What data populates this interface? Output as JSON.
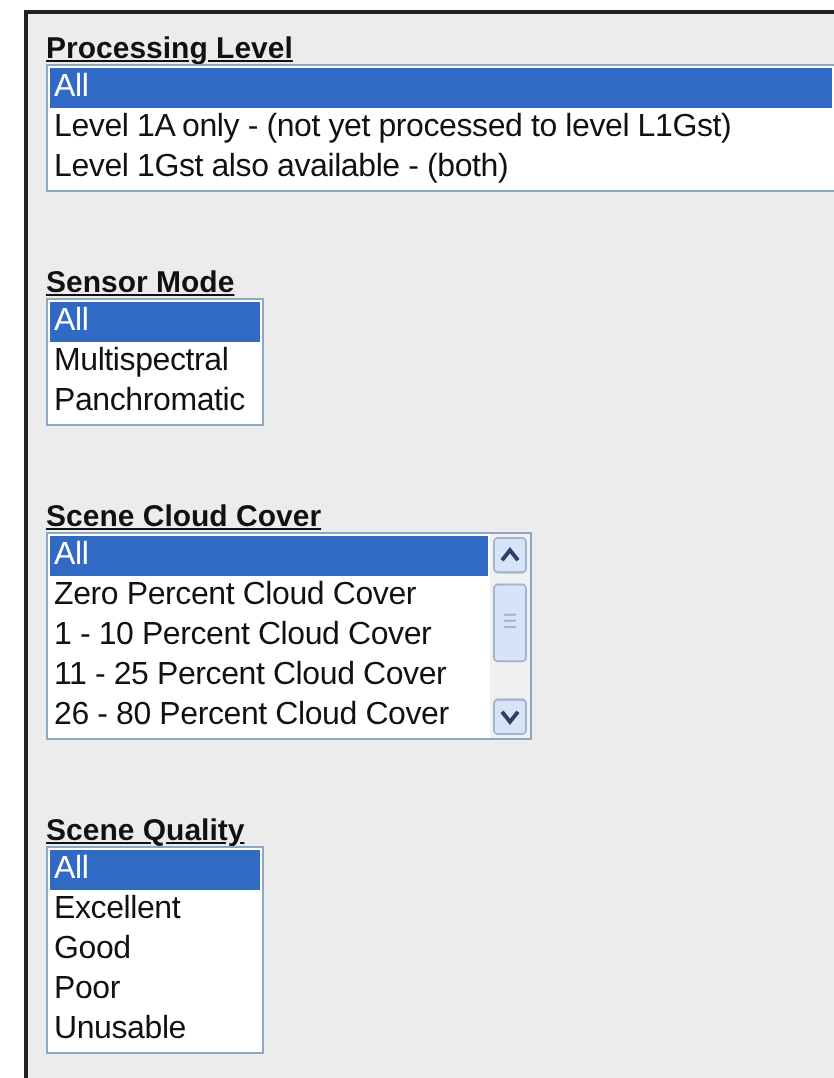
{
  "sections": [
    {
      "heading": "Processing Level",
      "kind": "wide",
      "options": [
        {
          "label": "All",
          "selected": true
        },
        {
          "label": "Level 1A only - (not yet processed to level L1Gst)",
          "selected": false
        },
        {
          "label": "Level 1Gst also available - (both)",
          "selected": false
        }
      ]
    },
    {
      "heading": "Sensor Mode",
      "kind": "plain",
      "options": [
        {
          "label": "All",
          "selected": true
        },
        {
          "label": "Multispectral",
          "selected": false
        },
        {
          "label": "Panchromatic",
          "selected": false
        }
      ]
    },
    {
      "heading": "Scene Cloud Cover",
      "kind": "scrolling",
      "options": [
        {
          "label": "All",
          "selected": true
        },
        {
          "label": "Zero Percent Cloud Cover",
          "selected": false
        },
        {
          "label": "1 - 10 Percent Cloud Cover",
          "selected": false
        },
        {
          "label": "11 - 25 Percent Cloud Cover",
          "selected": false
        },
        {
          "label": "26 - 80 Percent Cloud Cover",
          "selected": false
        }
      ]
    },
    {
      "heading": "Scene Quality",
      "kind": "plain",
      "options": [
        {
          "label": "All",
          "selected": true
        },
        {
          "label": "Excellent",
          "selected": false
        },
        {
          "label": "Good",
          "selected": false
        },
        {
          "label": "Poor",
          "selected": false
        },
        {
          "label": "Unusable",
          "selected": false
        }
      ]
    }
  ]
}
